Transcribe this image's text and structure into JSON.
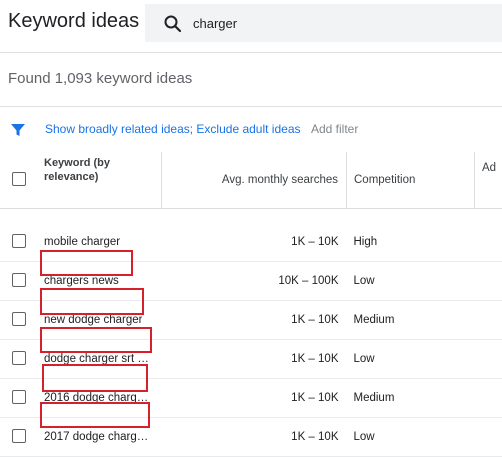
{
  "header": {
    "title": "Keyword ideas"
  },
  "search": {
    "icon": "search-icon",
    "value": "charger"
  },
  "summary": {
    "found_text": "Found 1,093 keyword ideas"
  },
  "filters": {
    "icon": "filter-icon",
    "applied_text": "Show broadly related ideas; Exclude adult ideas",
    "add_filter_label": "Add filter"
  },
  "table": {
    "columns": {
      "keyword": "Keyword (by relevance)",
      "searches": "Avg. monthly searches",
      "competition": "Competition",
      "extra": "Ad"
    },
    "rows": [
      {
        "keyword": "mobile charger",
        "searches": "1K – 10K",
        "competition": "High"
      },
      {
        "keyword": "chargers news",
        "searches": "10K – 100K",
        "competition": "Low"
      },
      {
        "keyword": "new dodge charger",
        "searches": "1K – 10K",
        "competition": "Medium"
      },
      {
        "keyword": "dodge charger srt …",
        "searches": "1K – 10K",
        "competition": "Low"
      },
      {
        "keyword": "2016 dodge charg…",
        "searches": "1K – 10K",
        "competition": "Medium"
      },
      {
        "keyword": "2017 dodge charg…",
        "searches": "1K – 10K",
        "competition": "Low"
      }
    ]
  },
  "colors": {
    "link": "#1a73e8",
    "highlight": "#d6212b",
    "search_bg": "#f1f3f4"
  }
}
